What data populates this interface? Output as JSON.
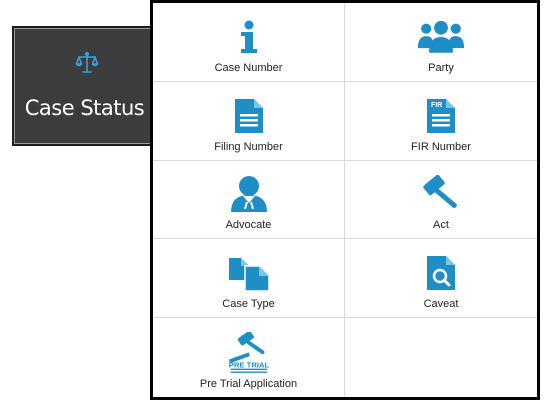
{
  "case_status_tile": {
    "label": "Case Status",
    "icon": "balance-scale-icon"
  },
  "menu": {
    "accent_color": "#1e8fc6",
    "items": [
      {
        "key": "case-number",
        "label": "Case Number",
        "icon": "info-icon"
      },
      {
        "key": "party",
        "label": "Party",
        "icon": "group-icon"
      },
      {
        "key": "filing-number",
        "label": "Filing Number",
        "icon": "document-icon"
      },
      {
        "key": "fir-number",
        "label": "FIR Number",
        "icon": "fir-document-icon",
        "icon_text": "FIR"
      },
      {
        "key": "advocate",
        "label": "Advocate",
        "icon": "advocate-icon"
      },
      {
        "key": "act",
        "label": "Act",
        "icon": "gavel-icon"
      },
      {
        "key": "case-type",
        "label": "Case Type",
        "icon": "copy-files-icon"
      },
      {
        "key": "caveat",
        "label": "Caveat",
        "icon": "document-search-icon"
      },
      {
        "key": "pre-trial-application",
        "label": "Pre Trial Application",
        "icon": "pre-trial-gavel-icon",
        "icon_text": "PRE TRIAL"
      }
    ]
  }
}
